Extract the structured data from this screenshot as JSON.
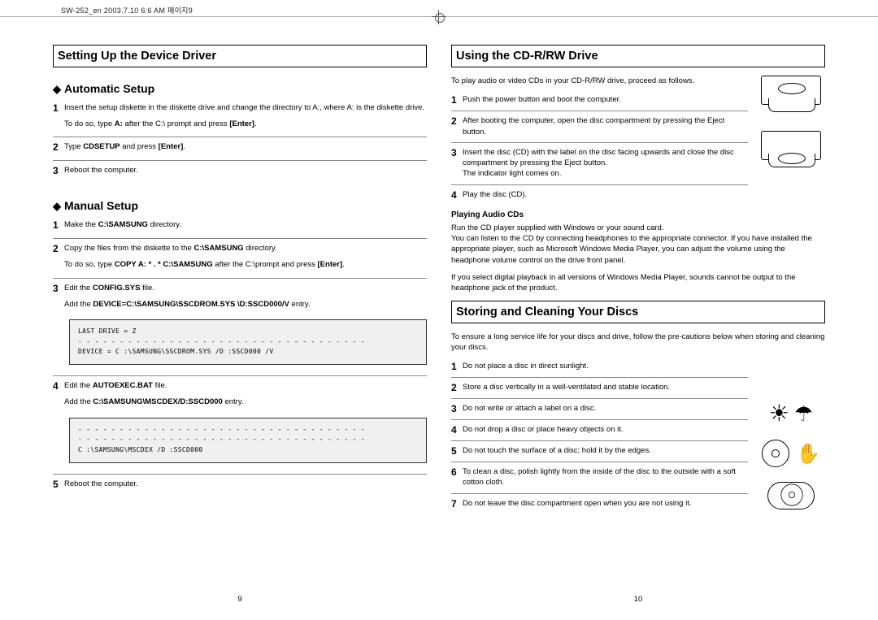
{
  "header_line": "SW-252_en  2003.7.10 6:6 AM  페이지9",
  "left": {
    "title": "Setting Up the Device Driver",
    "auto": {
      "header": "Automatic Setup",
      "step1": "Insert the setup diskette in the diskette drive and change the directory to A:, where A: is the diskette drive.",
      "step1_cont_pre": "To do so, type ",
      "step1_cont_bold1": "A:",
      "step1_cont_mid": " after the C:\\ prompt and press ",
      "step1_cont_bold2": "[Enter]",
      "step2_pre": "Type ",
      "step2_bold": "CDSETUP",
      "step2_mid": " and press ",
      "step2_bold2": "[Enter]",
      "step3": "Reboot the computer."
    },
    "manual": {
      "header": "Manual Setup",
      "step1_pre": "Make the ",
      "step1_bold": "C:\\SAMSUNG",
      "step1_post": " directory.",
      "step2_pre": "Copy the files from the diskette to the ",
      "step2_bold": "C:\\SAMSUNG",
      "step2_post": " directory.",
      "step2_cont_pre": "To do so, type ",
      "step2_cont_bold1": "COPY A: * . * C:\\SAMSUNG",
      "step2_cont_mid": " after the C:\\prompt and press ",
      "step2_cont_bold2": "[Enter]",
      "step3_pre": "Edit the ",
      "step3_bold": "CONFIG.SYS",
      "step3_post": " file.",
      "step3_cont_pre": "Add the ",
      "step3_cont_bold": "DEVICE=C:\\SAMSUNG\\SSCDROM.SYS \\D:SSCD000/V",
      "step3_cont_post": " entry.",
      "codebox1_l1": "LAST DRIVE = Z",
      "codebox1_l2": "- - - - - - - - - - - - - - - - - - - - - - - - - - - - - - - - - - -",
      "codebox1_l3": "DEVICE = C :\\SAMSUNG\\SSCDROM.SYS /D :SSCD000 /V",
      "step4_pre": "Edit the ",
      "step4_bold": "AUTOEXEC.BAT",
      "step4_post": " file.",
      "step4_cont_pre": "Add the ",
      "step4_cont_bold": "C:\\SAMSUNG\\MSCDEX/D:SSCD000",
      "step4_cont_post": " entry.",
      "codebox2_l1": "- - - - - - - - - - - - - - - - - - - - - - - - - - - - - - - - - - -",
      "codebox2_l2": "- - - - - - - - - - - - - - - - - - - - - - - - - - - - - - - - - - -",
      "codebox2_l3": "C :\\SAMSUNG\\MSCDEX /D :SSCD000",
      "step5": "Reboot the computer."
    },
    "pagenum": "9"
  },
  "right": {
    "title1": "Using the CD-R/RW Drive",
    "intro1": "To play audio or video CDs in your CD-R/RW drive, proceed as follows.",
    "u_step1": "Push the power button and boot the computer.",
    "u_step2": "After booting the computer, open the disc compartment by pressing the Eject button.",
    "u_step3": "Insert the disc (CD) with the label on the disc facing upwards and close the disc compartment by pressing the Eject button.\nThe indicator light comes on.",
    "u_step4": "Play the disc (CD).",
    "playing_header": "Playing Audio CDs",
    "playing_p1": "Run the CD player supplied with Windows or your sound card.\nYou can listen to the CD by connecting headphones to the appropriate connector. If you have installed the appropriate player, such as Microsoft Windows Media Player, you can adjust the volume using the headphone volume control on the drive front panel.",
    "playing_p2": "If you select digital playback in all versions of Windows Media Player, sounds cannot be output to the headphone jack of the product.",
    "title2": "Storing and Cleaning Your Discs",
    "intro2": "To ensure a long service life for your discs and drive, follow the pre-cautions below when storing and cleaning your discs.",
    "s_step1": "Do not place a disc in direct sunlight.",
    "s_step2": "Store a disc vertically in a well-ventilated and stable location.",
    "s_step3": "Do not write or attach a label on a disc.",
    "s_step4": "Do not drop a disc or place heavy objects on it.",
    "s_step5": "Do not touch the surface of a disc; hold it by the edges.",
    "s_step6": "To clean a disc, polish lightly from the inside of the disc to the outside with a soft cotton cloth.",
    "s_step7": "Do not leave the disc compartment open when you are not using it.",
    "pagenum": "10"
  }
}
